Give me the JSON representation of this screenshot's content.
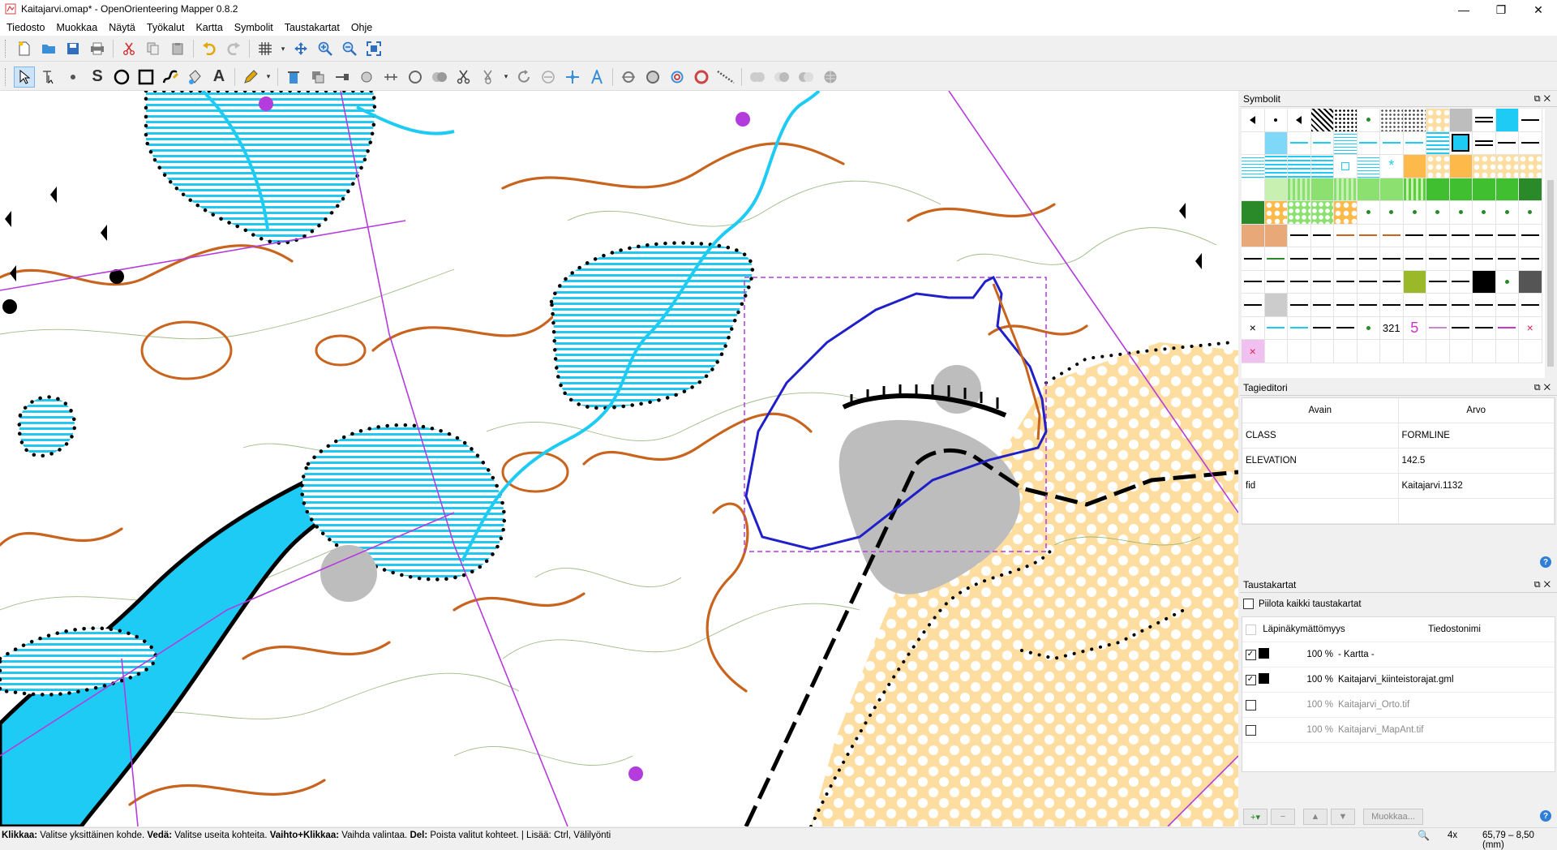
{
  "window": {
    "title": "Kaitajarvi.omap* - OpenOrienteering Mapper 0.8.2",
    "buttons": [
      "—",
      "❐",
      "✕"
    ]
  },
  "menu": [
    "Tiedosto",
    "Muokkaa",
    "Näytä",
    "Työkalut",
    "Kartta",
    "Symbolit",
    "Taustakartat",
    "Ohje"
  ],
  "symbols_panel": {
    "title": "Symbolit",
    "number_symbol_text": "321",
    "five_symbol_text": "5"
  },
  "tag_editor": {
    "title": "Tagieditori",
    "columns": [
      "Avain",
      "Arvo"
    ],
    "rows": [
      {
        "key": "CLASS",
        "value": "FORMLINE"
      },
      {
        "key": "ELEVATION",
        "value": "142.5"
      },
      {
        "key": "fid",
        "value": "Kaitajarvi.1132"
      }
    ]
  },
  "background_panel": {
    "title": "Taustakartat",
    "hide_all_label": "Piilota kaikki taustakartat",
    "columns": [
      "Läpinäkymättömyys",
      "Tiedostonimi"
    ],
    "rows": [
      {
        "checked": true,
        "swatch": true,
        "opacity": "100 %",
        "name": "- Kartta -",
        "dim": false
      },
      {
        "checked": true,
        "swatch": true,
        "opacity": "100 %",
        "name": "Kaitajarvi_kiinteistorajat.gml",
        "dim": false
      },
      {
        "checked": false,
        "swatch": false,
        "opacity": "100 %",
        "name": "Kaitajarvi_Orto.tif",
        "dim": true
      },
      {
        "checked": false,
        "swatch": false,
        "opacity": "100 %",
        "name": "Kaitajarvi_MapAnt.tif",
        "dim": true
      }
    ],
    "edit_button": "Muokkaa..."
  },
  "status": {
    "parts": [
      {
        "b": "Klikkaa:",
        "t": " Valitse yksittäinen kohde. "
      },
      {
        "b": "Vedä:",
        "t": " Valitse useita kohteita. "
      },
      {
        "b": "Vaihto+Klikkaa:",
        "t": " Vaihda valintaa. "
      },
      {
        "b": "Del:",
        "t": " Poista valitut kohteet. | Lisää: Ctrl, Välilyönti"
      }
    ],
    "zoom": "4x",
    "coords": "65,79 – 8,50 (mm)"
  },
  "colors": {
    "contour": "#c8641e",
    "water": "#1ecbf5",
    "marsh": "#23c8f0",
    "rough_open": "#fddea0",
    "rock": "#bdbdbd",
    "purple": "#b43cdc",
    "selection": "#2020c8"
  }
}
